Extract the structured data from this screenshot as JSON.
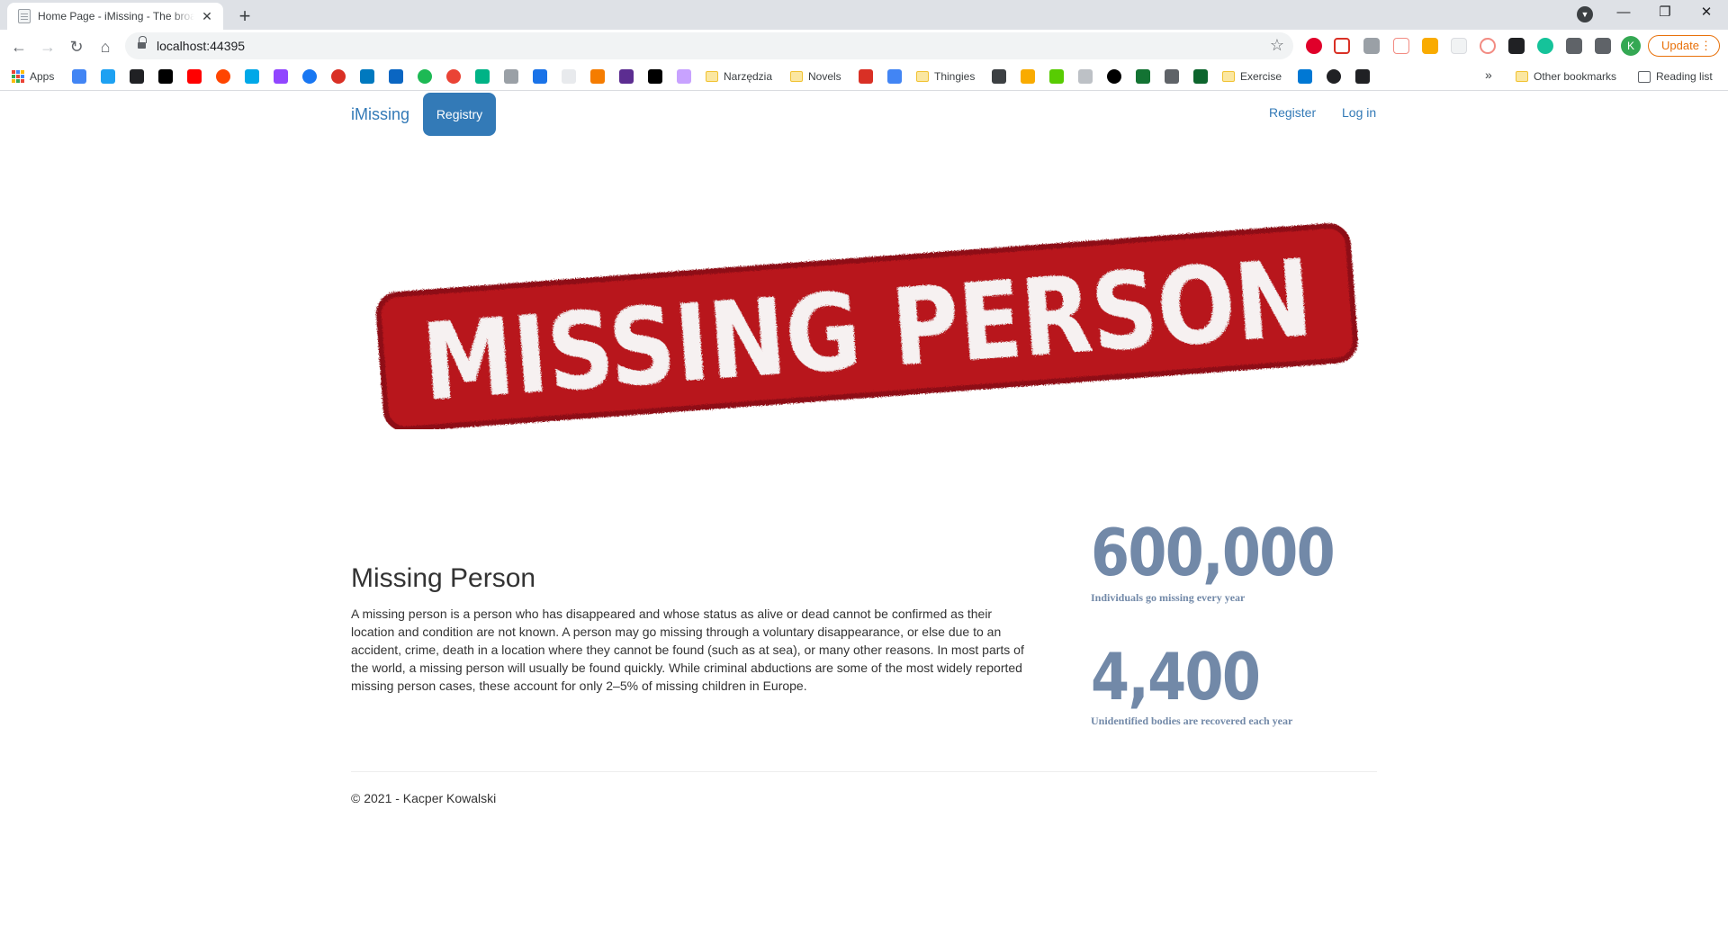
{
  "browser": {
    "tab_title": "Home Page - iMissing - The broad",
    "url": "localhost:44395",
    "update_label": "Update",
    "profile_initial": "K",
    "bookmarks": {
      "apps": "Apps",
      "narzedzia": "Narzędzia",
      "novels": "Novels",
      "thingies": "Thingies",
      "exercise": "Exercise",
      "other": "Other bookmarks",
      "reading": "Reading list"
    }
  },
  "nav": {
    "brand": "iMissing",
    "registry": "Registry",
    "register": "Register",
    "login": "Log in"
  },
  "banner": {
    "text": "MISSING PERSON",
    "color": "#b8141c"
  },
  "content": {
    "title": "Missing Person",
    "body": "A missing person is a person who has disappeared and whose status as alive or dead cannot be confirmed as their location and condition are not known. A person may go missing through a voluntary disappearance, or else due to an accident, crime, death in a location where they cannot be found (such as at sea), or many other reasons. In most parts of the world, a missing person will usually be found quickly. While criminal abductions are some of the most widely reported missing person cases, these account for only 2–5% of missing children in Europe."
  },
  "stats": [
    {
      "value": "600,000",
      "caption": "Individuals go missing every year"
    },
    {
      "value": "4,400",
      "caption": "Unidentified bodies are recovered each year"
    }
  ],
  "footer": {
    "text": "© 2021 - Kacper Kowalski"
  },
  "colors": {
    "link": "#337ab7",
    "stat": "#7289a8"
  }
}
